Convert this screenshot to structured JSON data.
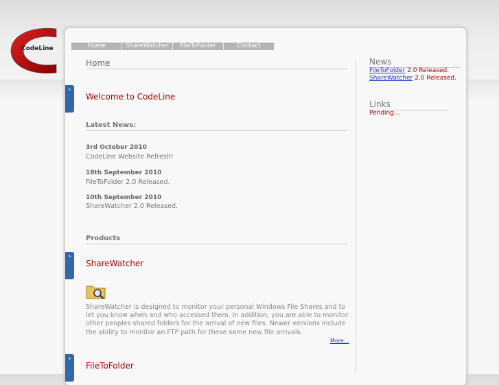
{
  "logo": {
    "text": "CodeLine"
  },
  "nav": [
    "Home",
    "ShareWatcher",
    "FileToFolder",
    "Contact"
  ],
  "page_title": "Home",
  "welcome": "Welcome to CodeLine",
  "latest_news_label": "Latest News:",
  "news": [
    {
      "date": "3rd October 2010",
      "text": "CodeLine Website Refresh!"
    },
    {
      "date": "18th September 2010",
      "text": "FileToFolder 2.0 Released."
    },
    {
      "date": "10th September 2010",
      "text": "ShareWatcher 2.0 Released."
    }
  ],
  "products_label": "Products",
  "products": [
    {
      "title": "ShareWatcher",
      "description": "ShareWatcher is designed to monitor your personal Windows File Shares and to let you know when and who accessed them. In addition, you are able to monitor other peoples shared folders for the arrival of new files. Newer versions include the ability to monitor an FTP path for these same new file arrivals.",
      "more": "More..."
    },
    {
      "title": "FileToFolder"
    }
  ],
  "tab_glyph": "›",
  "sidebar": {
    "news_title": "News",
    "news_items": [
      {
        "link": "FileToFolder",
        "text": " 2.0 Released."
      },
      {
        "link": "ShareWatcher",
        "text": " 2.0 Released."
      }
    ],
    "links_title": "Links",
    "links_text": "Pending..."
  },
  "colors": {
    "accent_red": "#b00000",
    "link_blue": "#2233cc",
    "tab_blue": "#3366aa",
    "nav_gray": "#b4b4b4"
  }
}
